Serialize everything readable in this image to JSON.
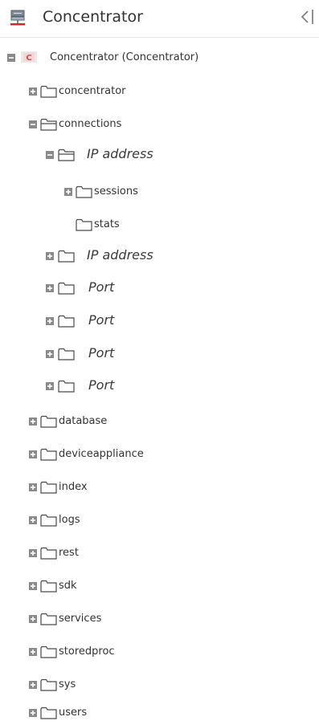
{
  "header": {
    "title": "Concentrator",
    "collapse_icon": "collapse-panel-icon"
  },
  "tree": {
    "root": {
      "label": "Concentrator (Concentrator)",
      "badge_letter": "C",
      "badge_color": "#d94a4a"
    },
    "items": [
      {
        "label": "concentrator"
      },
      {
        "label": "connections"
      },
      {
        "label": "IP address"
      },
      {
        "label": "sessions"
      },
      {
        "label": "stats"
      },
      {
        "label": "IP address"
      },
      {
        "label": "Port"
      },
      {
        "label": "Port"
      },
      {
        "label": "Port"
      },
      {
        "label": "Port"
      },
      {
        "label": "database"
      },
      {
        "label": "deviceappliance"
      },
      {
        "label": "index"
      },
      {
        "label": "logs"
      },
      {
        "label": "rest"
      },
      {
        "label": "sdk"
      },
      {
        "label": "services"
      },
      {
        "label": "storedproc"
      },
      {
        "label": "sys"
      },
      {
        "label": "users"
      }
    ]
  },
  "colors": {
    "toggle_fill": "#8a8a8a",
    "folder_stroke": "#4a4a4a",
    "text": "#333333",
    "header_icon_accent": "#cc2a2a"
  }
}
